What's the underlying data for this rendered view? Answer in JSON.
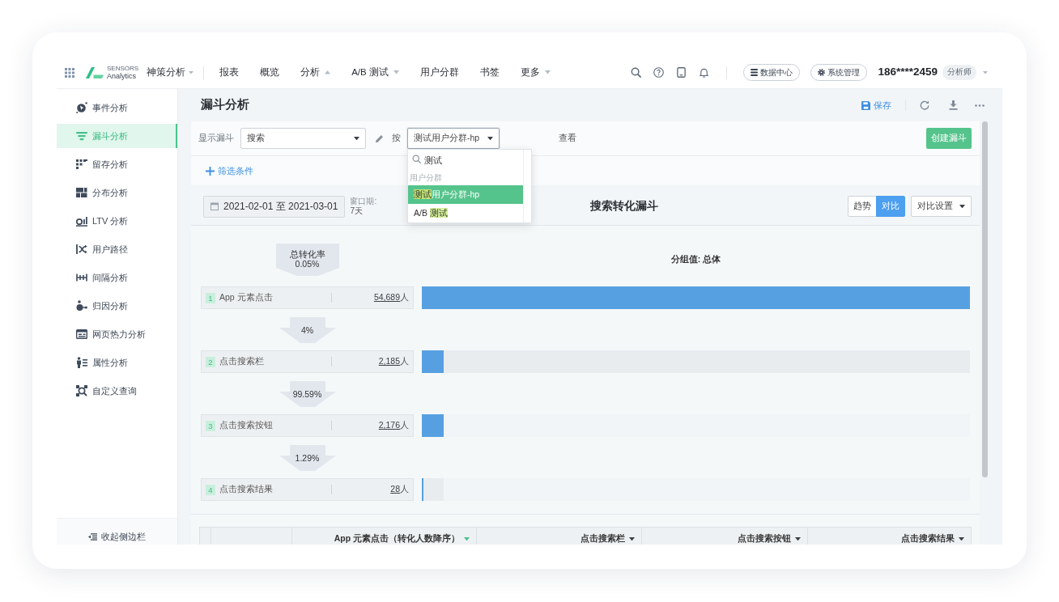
{
  "nav": {
    "logo": {
      "top": "SENSORS",
      "bottom": "Analytics"
    },
    "product": "神策分析",
    "items": [
      {
        "label": "报表"
      },
      {
        "label": "概览"
      },
      {
        "label": "分析",
        "expanded": true
      },
      {
        "label": "A/B 测试",
        "expanded": false
      },
      {
        "label": "用户分群"
      },
      {
        "label": "书签"
      },
      {
        "label": "更多",
        "expanded": false
      }
    ],
    "buttons": [
      {
        "label": "数据中心"
      },
      {
        "label": "系统管理"
      }
    ],
    "user": "186****2459",
    "role": "分析师"
  },
  "sidebar": {
    "items": [
      {
        "label": "事件分析",
        "selected": false
      },
      {
        "label": "漏斗分析",
        "selected": true
      },
      {
        "label": "留存分析",
        "selected": false
      },
      {
        "label": "分布分析",
        "selected": false
      },
      {
        "label": "LTV 分析",
        "selected": false
      },
      {
        "label": "用户路径",
        "selected": false
      },
      {
        "label": "间隔分析",
        "selected": false
      },
      {
        "label": "归因分析",
        "selected": false
      },
      {
        "label": "网页热力分析",
        "selected": false
      },
      {
        "label": "属性分析",
        "selected": false
      },
      {
        "label": "自定义查询",
        "selected": false
      }
    ],
    "collapse": "收起侧边栏"
  },
  "page": {
    "title": "漏斗分析",
    "save": "保存"
  },
  "filters": {
    "show_label": "显示漏斗",
    "funnel": "搜索",
    "by_label": "按",
    "group_by": "测试用户分群-hp",
    "view_label": "查看",
    "create": "创建漏斗",
    "add_filter": "筛选条件"
  },
  "dropdown": {
    "search": "测试",
    "group": "用户分群",
    "options": [
      {
        "match": "测试",
        "after": "用户分群-hp",
        "selected": true
      },
      {
        "before": "A/B ",
        "match": "测试",
        "selected": false
      }
    ]
  },
  "chart": {
    "date_range": "2021-02-01 至 2021-03-01",
    "window_label": "窗口期:",
    "window_value": "7天",
    "title": "搜索转化漏斗",
    "modes": [
      {
        "label": "趋势",
        "selected": false
      },
      {
        "label": "对比",
        "selected": true
      }
    ],
    "settings": "对比设置",
    "overall_label": "总转化率",
    "overall_rate": "0.05%",
    "group_label": "分组值: 总体",
    "steps": [
      {
        "number": "1",
        "name": "App 元素点击",
        "count": "54,689",
        "unit": "人",
        "level": 1
      },
      {
        "rate": "4%",
        "number": "2",
        "name": "点击搜索栏",
        "count": "2,185",
        "unit": "人",
        "level": 0.04
      },
      {
        "rate": "99.59%",
        "number": "3",
        "name": "点击搜索按钮",
        "count": "2,176",
        "unit": "人",
        "level": 0.0398
      },
      {
        "rate": "1.29%",
        "number": "4",
        "name": "点击搜索结果",
        "count": "28",
        "unit": "人",
        "level": 0.0005
      }
    ]
  },
  "table": {
    "columns": [
      {
        "label": "App 元素点击（转化人数降序）",
        "sorted": true
      },
      {
        "label": "点击搜索栏",
        "sorted": false
      },
      {
        "label": "点击搜索按钮",
        "sorted": false
      },
      {
        "label": "点击搜索结果",
        "sorted": false
      }
    ]
  }
}
